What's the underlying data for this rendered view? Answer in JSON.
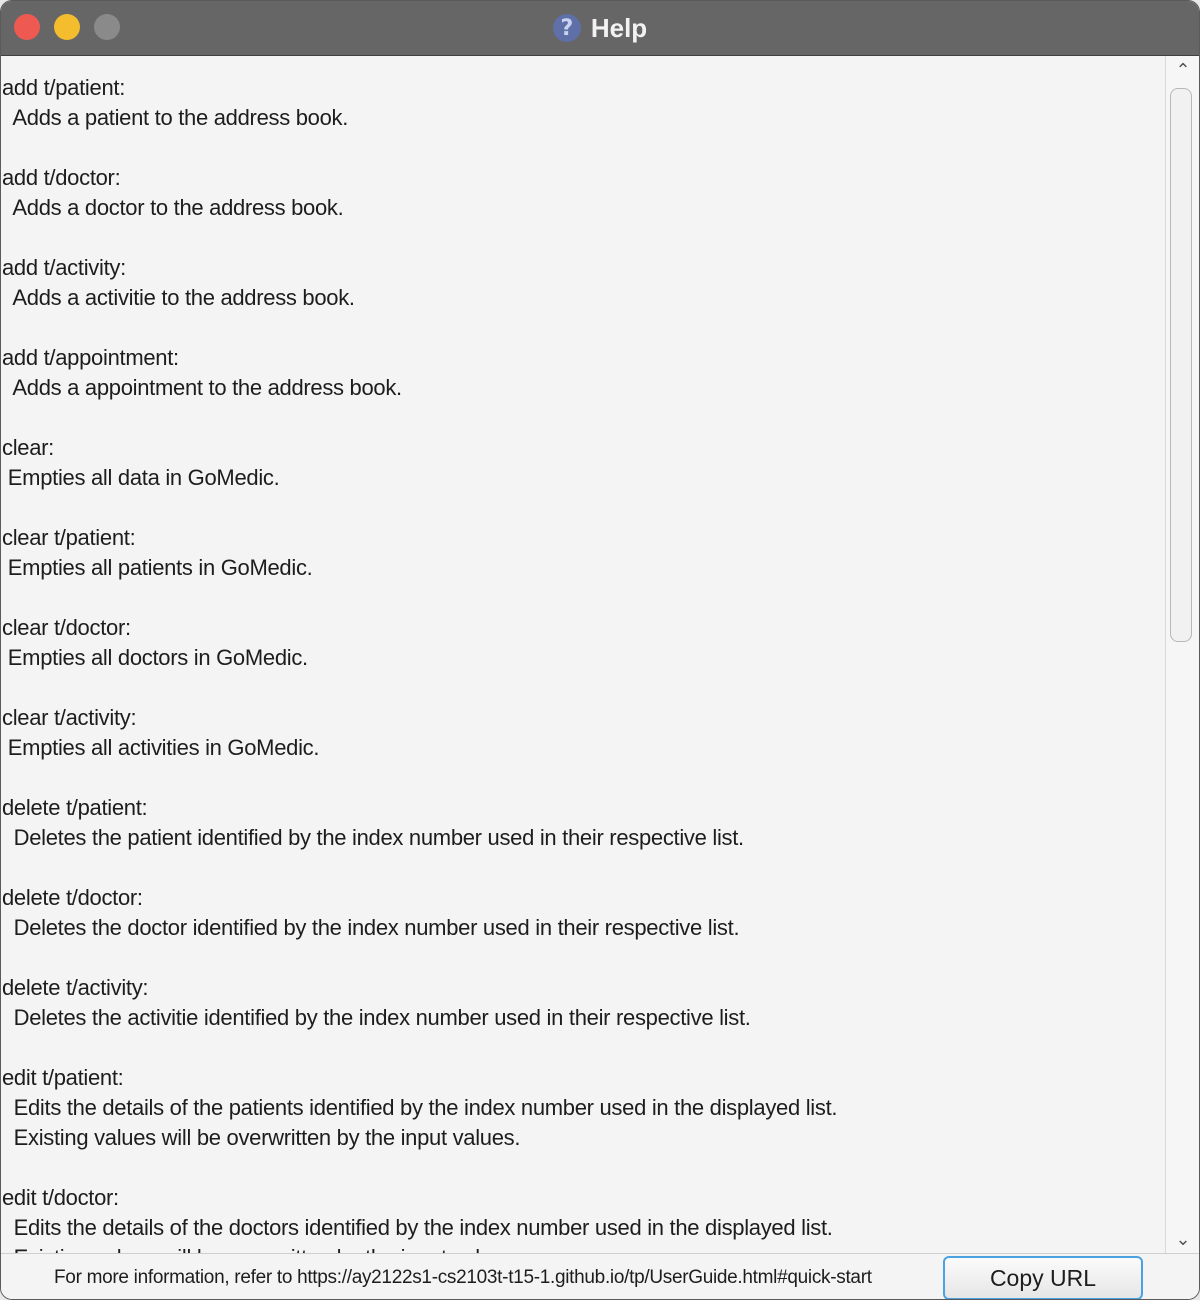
{
  "window": {
    "title": "Help",
    "title_icon": "help-question-icon"
  },
  "help": {
    "text": "add t/patient:\n  Adds a patient to the address book.\n\nadd t/doctor:\n  Adds a doctor to the address book.\n\nadd t/activity:\n  Adds a activitie to the address book.\n\nadd t/appointment:\n  Adds a appointment to the address book.\n\nclear:\n Empties all data in GoMedic.\n\nclear t/patient:\n Empties all patients in GoMedic.\n\nclear t/doctor:\n Empties all doctors in GoMedic.\n\nclear t/activity:\n Empties all activities in GoMedic.\n\ndelete t/patient:\n  Deletes the patient identified by the index number used in their respective list.\n\ndelete t/doctor:\n  Deletes the doctor identified by the index number used in their respective list.\n\ndelete t/activity:\n  Deletes the activitie identified by the index number used in their respective list.\n\nedit t/patient:\n  Edits the details of the patients identified by the index number used in the displayed list.\n  Existing values will be overwritten by the input values.\n\nedit t/doctor:\n  Edits the details of the doctors identified by the index number used in the displayed list.\n  Existing values will be overwritten by the input values."
  },
  "footer": {
    "info": "For more information, refer to https://ay2122s1-cs2103t-t15-1.github.io/tp/UserGuide.html#quick-start",
    "copy_button": "Copy URL"
  },
  "scrollbar": {
    "up_icon": "chevron-up-icon",
    "down_icon": "chevron-down-icon"
  }
}
